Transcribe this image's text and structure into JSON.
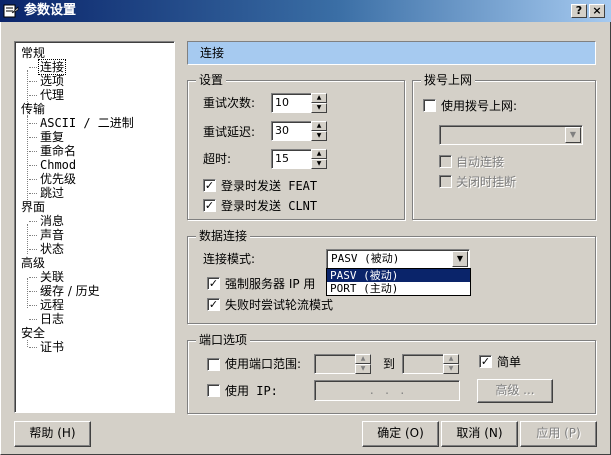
{
  "window": {
    "title": "参数设置",
    "icon": "settings-app-icon",
    "help_glyph": "?",
    "close_glyph": "×"
  },
  "tree": {
    "items": [
      {
        "label": "常规",
        "level": 0
      },
      {
        "label": "连接",
        "level": 1,
        "selected": true
      },
      {
        "label": "选项",
        "level": 1
      },
      {
        "label": "代理",
        "level": 1
      },
      {
        "label": "传输",
        "level": 0
      },
      {
        "label": "ASCII / 二进制",
        "level": 1
      },
      {
        "label": "重复",
        "level": 1
      },
      {
        "label": "重命名",
        "level": 1
      },
      {
        "label": "Chmod",
        "level": 1
      },
      {
        "label": "优先级",
        "level": 1
      },
      {
        "label": "跳过",
        "level": 1
      },
      {
        "label": "界面",
        "level": 0
      },
      {
        "label": "消息",
        "level": 1
      },
      {
        "label": "声音",
        "level": 1
      },
      {
        "label": "状态",
        "level": 1
      },
      {
        "label": "高级",
        "level": 0
      },
      {
        "label": "关联",
        "level": 1
      },
      {
        "label": "缓存 / 历史",
        "level": 1
      },
      {
        "label": "远程",
        "level": 1
      },
      {
        "label": "日志",
        "level": 1
      },
      {
        "label": "安全",
        "level": 0
      },
      {
        "label": "证书",
        "level": 1
      }
    ]
  },
  "panel": {
    "title": "连接"
  },
  "settings": {
    "legend": "设置",
    "retry_count_label": "重试次数:",
    "retry_count_value": "10",
    "retry_delay_label": "重试延迟:",
    "retry_delay_value": "30",
    "timeout_label": "超时:",
    "timeout_value": "15",
    "feat_label": "登录时发送 FEAT",
    "feat_checked": true,
    "clnt_label": "登录时发送 CLNT",
    "clnt_checked": true
  },
  "dialup": {
    "legend": "拨号上网",
    "use_dialup_label": "使用拨号上网:",
    "use_dialup_checked": false,
    "connection_value": "",
    "auto_connect_label": "自动连接",
    "hangup_on_close_label": "关闭时挂断"
  },
  "data_connection": {
    "legend": "数据连接",
    "mode_label": "连接模式:",
    "mode_value": "PASV (被动)",
    "mode_options": [
      "PASV (被动)",
      "PORT (主动)"
    ],
    "force_ip_label": "强制服务器 IP 用",
    "force_ip_checked": true,
    "fallback_label": "失败时尝试轮流模式",
    "fallback_checked": true
  },
  "ports": {
    "legend": "端口选项",
    "use_range_label": "使用端口范围:",
    "use_range_checked": false,
    "to_label": "到",
    "simple_label": "简单",
    "simple_checked": true,
    "use_ip_label": "使用 IP:",
    "use_ip_checked": false,
    "ip_placeholder": ".   .   .",
    "advanced_label": "高级 ..."
  },
  "footer": {
    "help_label": "帮助 (H)",
    "ok_label": "确定 (O)",
    "cancel_label": "取消 (N)",
    "apply_label": "应用 (P)"
  },
  "colors": {
    "title_start": "#0a246a",
    "title_end": "#a6caf0",
    "panel_header": "#a6caf0",
    "window_bg": "#d4d0c8",
    "selection": "#0a246a"
  }
}
